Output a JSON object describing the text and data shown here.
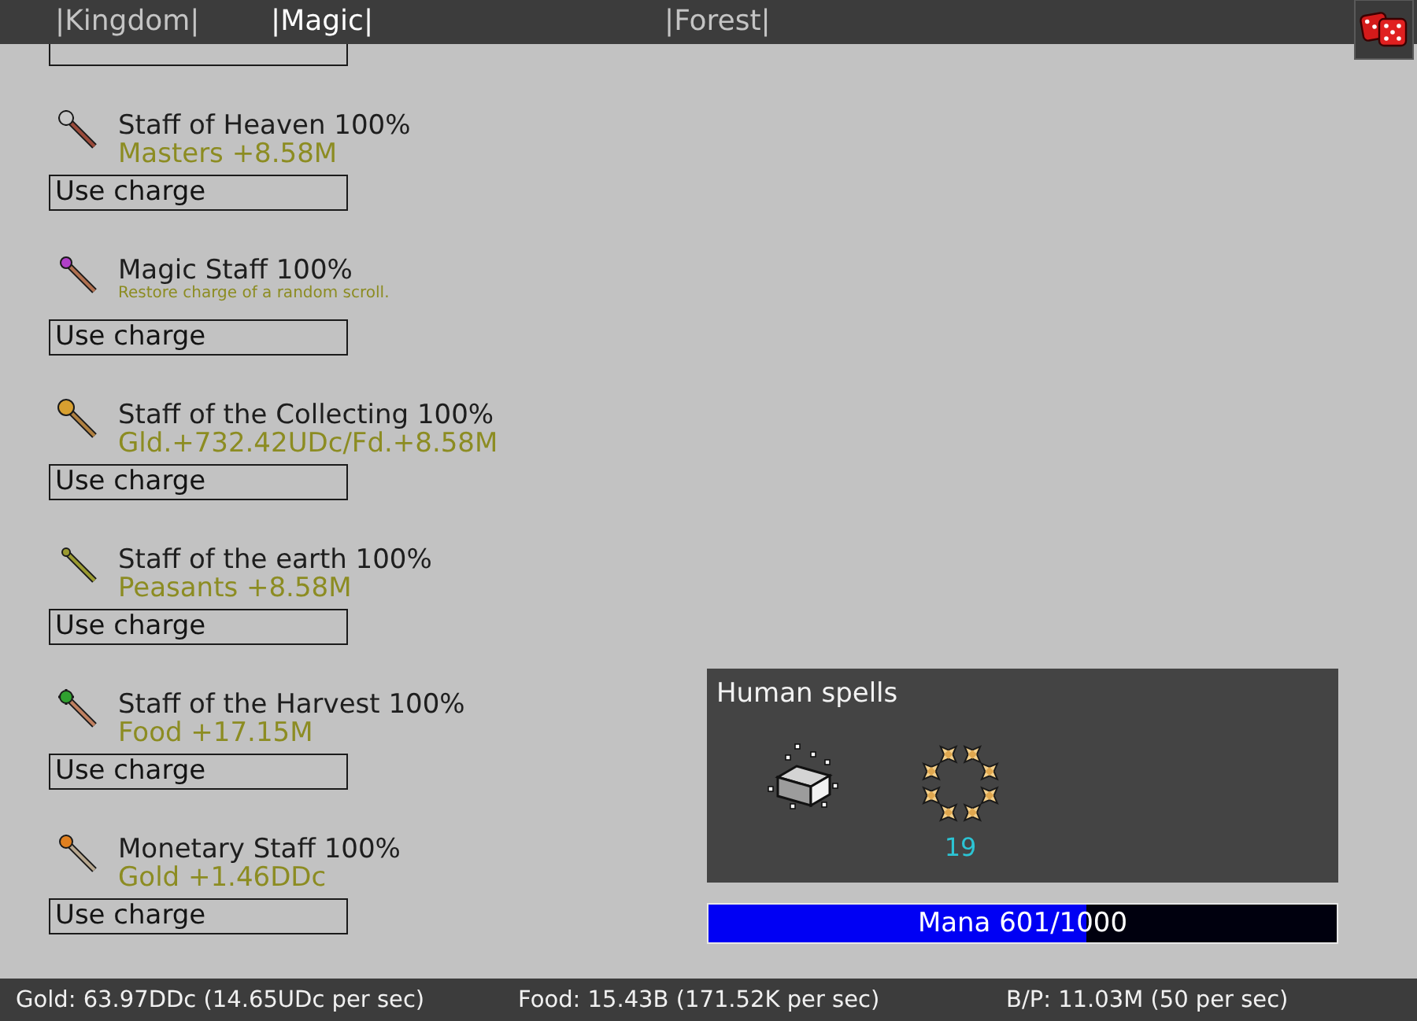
{
  "tabs": [
    {
      "label": "|Kingdom|",
      "selected": false
    },
    {
      "label": "|Magic|",
      "selected": true
    },
    {
      "label": "|Forest|",
      "selected": false
    }
  ],
  "staffs": [
    {
      "name": "Staff of Heaven 100%",
      "kind": "bonus",
      "effect": "Masters +8.58M",
      "button": "Use charge"
    },
    {
      "name": "Magic Staff 100%",
      "kind": "description",
      "effect": "Restore charge of a random scroll.",
      "button": "Use charge"
    },
    {
      "name": "Staff of the Collecting 100%",
      "kind": "bonus",
      "effect": "Gld.+732.42UDc/Fd.+8.58M",
      "button": "Use charge"
    },
    {
      "name": "Staff of the earth 100%",
      "kind": "bonus",
      "effect": "Peasants +8.58M",
      "button": "Use charge"
    },
    {
      "name": "Staff of the Harvest 100%",
      "kind": "bonus",
      "effect": "Food +17.15M",
      "button": "Use charge"
    },
    {
      "name": "Monetary Staff 100%",
      "kind": "bonus",
      "effect": "Gold +1.46DDc",
      "button": "Use charge"
    }
  ],
  "spells_panel": {
    "title": "Human spells",
    "spells": [
      {
        "kind": "ingot"
      },
      {
        "kind": "star-ring",
        "count": "19"
      }
    ]
  },
  "mana": {
    "label": "Mana 601/1000",
    "level": 0.601
  },
  "status_bar": [
    "Gold: 63.97DDc (14.65UDc per sec)",
    "Food: 15.43B (171.52K per sec)",
    "B/P: 11.03M (50 per sec)"
  ]
}
